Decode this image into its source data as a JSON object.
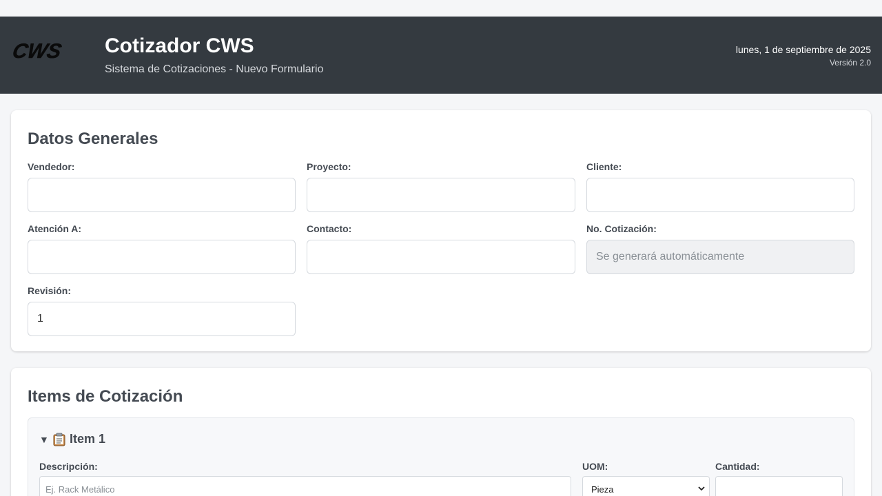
{
  "header": {
    "logo_text": "CWS",
    "title": "Cotizador CWS",
    "subtitle": "Sistema de Cotizaciones - Nuevo Formulario",
    "date": "lunes, 1 de septiembre de 2025",
    "version": "Versión 2.0"
  },
  "general": {
    "title": "Datos Generales",
    "fields": {
      "vendedor": {
        "label": "Vendedor:",
        "value": ""
      },
      "proyecto": {
        "label": "Proyecto:",
        "value": ""
      },
      "cliente": {
        "label": "Cliente:",
        "value": ""
      },
      "atencion": {
        "label": "Atención A:",
        "value": ""
      },
      "contacto": {
        "label": "Contacto:",
        "value": ""
      },
      "no_cotizacion": {
        "label": "No. Cotización:",
        "value": "",
        "placeholder": "Se generará automáticamente"
      },
      "revision": {
        "label": "Revisión:",
        "value": "1"
      }
    }
  },
  "items": {
    "title": "Items de Cotización",
    "item1": {
      "icon": "clipboard-icon",
      "toggle_icon": "triangle-down-icon",
      "title": "Item 1",
      "descripcion": {
        "label": "Descripción:",
        "placeholder": "Ej. Rack Metálico",
        "value": ""
      },
      "uom": {
        "label": "UOM:",
        "value": "Pieza"
      },
      "cantidad": {
        "label": "Cantidad:",
        "value": ""
      }
    }
  },
  "colors": {
    "header_bg": "#343a40",
    "page_bg": "#f5f6f8",
    "card_bg": "#ffffff",
    "text": "#444a52"
  }
}
